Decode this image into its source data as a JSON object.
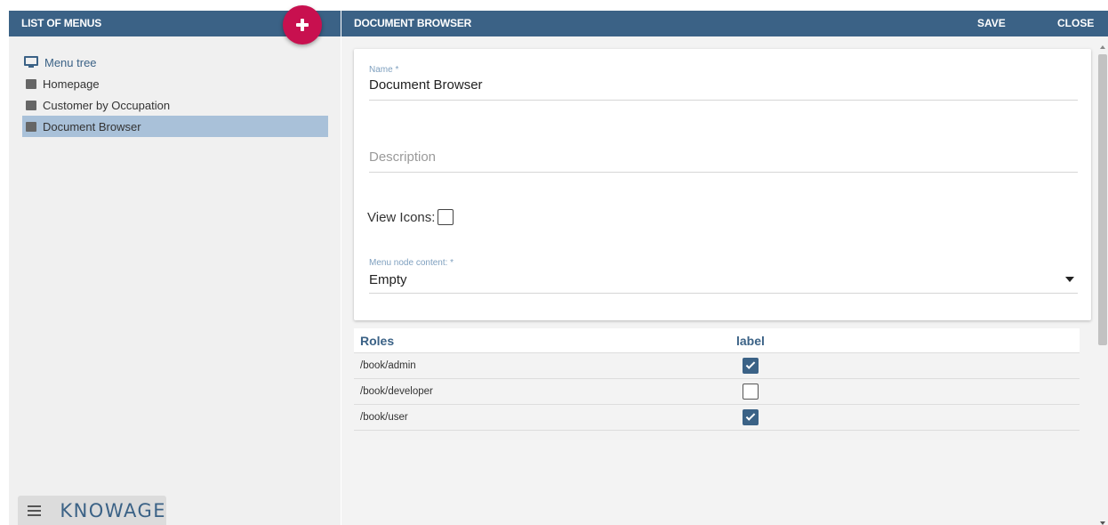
{
  "left": {
    "header": "LIST OF MENUS",
    "tree": [
      {
        "label": "Menu tree",
        "icon": "monitor-icon"
      },
      {
        "label": "Homepage",
        "icon": "square-icon"
      },
      {
        "label": "Customer by Occupation",
        "icon": "square-icon"
      },
      {
        "label": "Document Browser",
        "icon": "square-icon",
        "selected": true
      }
    ],
    "brand": "KNOWAGE"
  },
  "right": {
    "header": "DOCUMENT BROWSER",
    "save": "SAVE",
    "close": "CLOSE",
    "form": {
      "name_label": "Name *",
      "name_value": "Document Browser",
      "description_placeholder": "Description",
      "view_icons_label": "View Icons:",
      "view_icons_checked": false,
      "content_label": "Menu node content: *",
      "content_value": "Empty"
    },
    "roles": {
      "headers": [
        "Roles",
        "label"
      ],
      "rows": [
        {
          "role": "/book/admin",
          "checked": true
        },
        {
          "role": "/book/developer",
          "checked": false
        },
        {
          "role": "/book/user",
          "checked": true
        }
      ]
    }
  },
  "colors": {
    "header_bg": "#3b6286",
    "accent": "#c8104f",
    "selected_row": "#a9c1d9"
  }
}
